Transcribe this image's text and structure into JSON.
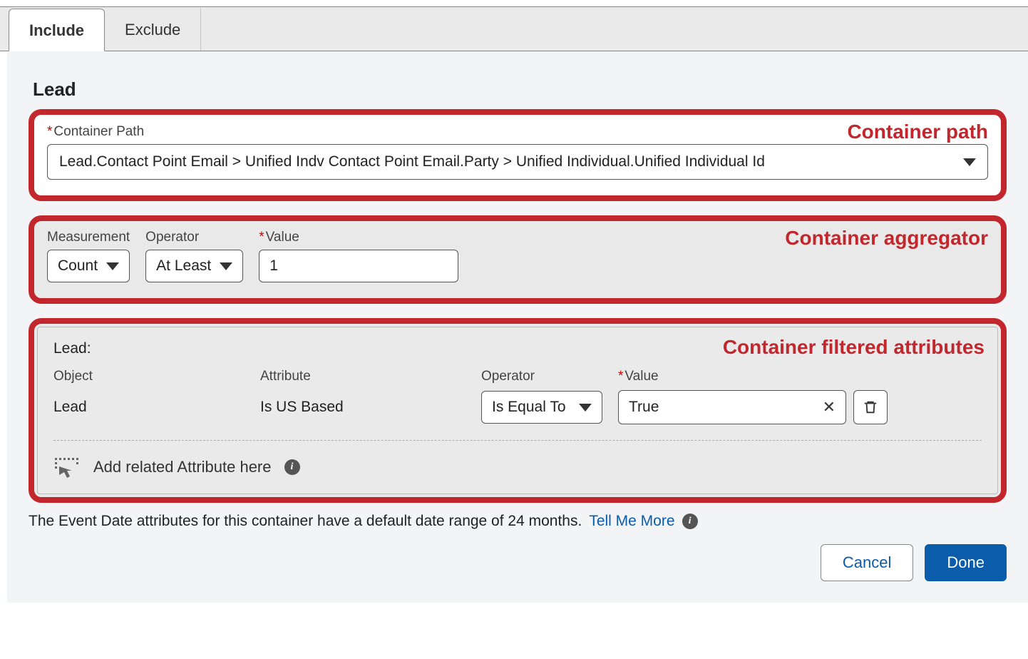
{
  "tabs": {
    "include": "Include",
    "exclude": "Exclude"
  },
  "section_title": "Lead",
  "annotations": {
    "path": "Container path",
    "aggregator": "Container aggregator",
    "attributes": "Container filtered attributes"
  },
  "container_path": {
    "label": "Container Path",
    "value": "Lead.Contact Point Email > Unified Indv Contact Point Email.Party > Unified Individual.Unified Individual Id"
  },
  "aggregator": {
    "measurement_label": "Measurement",
    "measurement_value": "Count",
    "operator_label": "Operator",
    "operator_value": "At Least",
    "value_label": "Value",
    "value": "1"
  },
  "filtered": {
    "heading": "Lead:",
    "cols": {
      "object": "Object",
      "attribute": "Attribute",
      "operator": "Operator",
      "value": "Value"
    },
    "row": {
      "object": "Lead",
      "attribute": "Is US Based",
      "operator": "Is Equal To",
      "value": "True"
    },
    "add_label": "Add related Attribute here"
  },
  "footer": {
    "note": "The Event Date attributes for this container have a default date range of 24 months.",
    "link": "Tell Me More"
  },
  "buttons": {
    "cancel": "Cancel",
    "done": "Done"
  }
}
